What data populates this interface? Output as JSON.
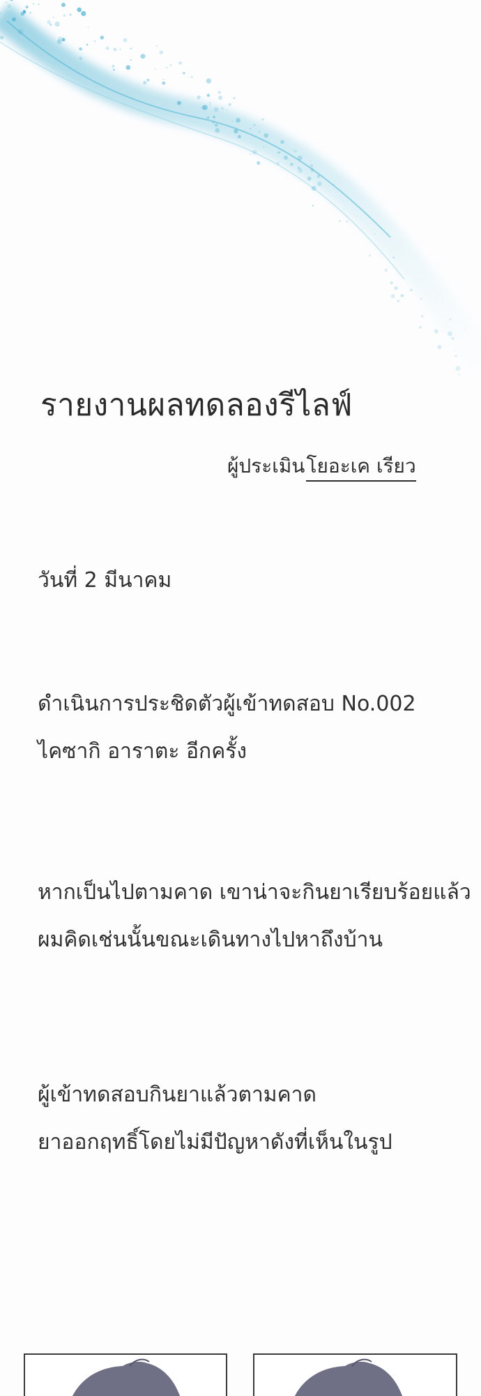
{
  "report": {
    "title": "รายงานผลทดลองรีไลฟ์",
    "evaluator_label": "ผู้ประเมิน",
    "evaluator_name": "โยอะเค เรียว"
  },
  "entries": [
    "วันที่ 2 มีนาคม",
    "ดำเนินการประชิดตัวผู้เข้าทดสอบ No.002",
    "ไคซากิ อาราตะ อีกครั้ง",
    "หากเป็นไปตามคาด เขาน่าจะกินยาเรียบร้อยแล้ว",
    "ผมคิดเช่นนั้นขณะเดินทางไปหาถึงบ้าน",
    "ผู้เข้าทดสอบกินยาแล้วตามคาด",
    "ยาออกฤทธิ์โดยไม่มีปัญหาดังที่เห็นในรูป"
  ],
  "colors": {
    "background": "#fdfdfe",
    "sparkle": "#4fb8d6",
    "text": "#2b2b2b",
    "hair": "#6f6f86"
  }
}
